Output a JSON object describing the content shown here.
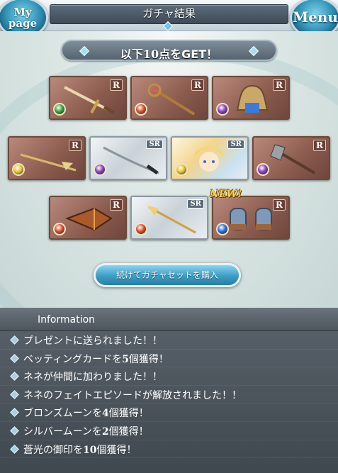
{
  "header": {
    "title": "ガチャ結果",
    "mypage_label": "My page",
    "menu_label": "Menu"
  },
  "banner": {
    "text_prefix": "以下",
    "count": "10",
    "text_suffix": "点をGET！"
  },
  "items": [
    {
      "rarity": "R",
      "element_color": "#3aa33a",
      "art": "sword-icon",
      "style": "r"
    },
    {
      "rarity": "R",
      "element_color": "#d9502a",
      "art": "staff-icon",
      "style": "r"
    },
    {
      "rarity": "R",
      "element_color": "#8a3ec2",
      "art": "bell-icon",
      "style": "r"
    },
    {
      "rarity": "R",
      "element_color": "#e8c22a",
      "art": "spear-icon",
      "style": "r"
    },
    {
      "rarity": "SR",
      "element_color": "#8a3ec2",
      "art": "katana-icon",
      "style": "sr"
    },
    {
      "rarity": "SR",
      "element_color": "#e8c22a",
      "art": "character-portrait-icon",
      "style": "chara"
    },
    {
      "rarity": "R",
      "element_color": "#8a3ec2",
      "art": "axe-icon",
      "style": "r"
    },
    {
      "rarity": "R",
      "element_color": "#d9502a",
      "art": "gauntlet-weapon-icon",
      "style": "r"
    },
    {
      "rarity": "SR",
      "element_color": "#d9502a",
      "art": "golden-spear-icon",
      "style": "sr"
    },
    {
      "rarity": "R",
      "element_color": "#2a6fd9",
      "art": "gloves-icon",
      "style": "r",
      "badge": "NEW!"
    }
  ],
  "buy_button": {
    "label": "続けてガチャセットを購入"
  },
  "information": {
    "title": "Information",
    "lines": [
      {
        "text": "プレゼントに送られました！！"
      },
      {
        "pre": "ベッティングカードを",
        "num": "5",
        "post": "個獲得！"
      },
      {
        "text": "ネネが仲間に加わりました！！"
      },
      {
        "text": "ネネのフェイトエピソードが解放されました！！"
      },
      {
        "pre": "ブロンズムーンを",
        "num": "4",
        "post": "個獲得！"
      },
      {
        "pre": "シルバームーンを",
        "num": "2",
        "post": "個獲得！"
      },
      {
        "pre": "蒼光の御印を",
        "num": "10",
        "post": "個獲得！"
      }
    ]
  }
}
